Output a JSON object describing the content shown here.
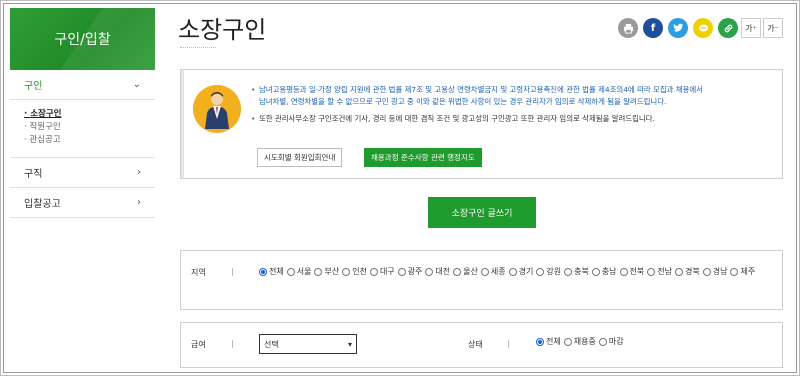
{
  "sidebar": {
    "title": "구인/입찰",
    "menu": [
      {
        "label": "구인",
        "expanded": true
      },
      {
        "label": "구직"
      },
      {
        "label": "입찰공고"
      }
    ],
    "sub_items": [
      "소장구인",
      "직원구인",
      "관심공고"
    ],
    "active_sub": "소장구인"
  },
  "page": {
    "title": "소장구인"
  },
  "share_icons": [
    "print-icon",
    "facebook-icon",
    "twitter-icon",
    "kakao-icon",
    "link-icon"
  ],
  "font_controls": {
    "increase": "가⁺",
    "decrease": "가⁻"
  },
  "notice": {
    "line1_a": "남녀고용평등과 일·가정 양립 지원에 관한 법률 제7조 및 고용상 연령차별금지 및 고령자고용촉진에 관한 법률 제4조의4에 따라 모집과 채용에서",
    "line1_b": "남녀차별, 연령차별을 할 수 없으므로 구인 광고 중 이와 같은 위법한 사항이 있는 경우 관리자가 임의로 삭제하게 됨을 알려드립니다.",
    "line2": "또한 관리사무소장 구인조건에 기사, 경리 등에 대한 겸직 조건 및 광고성의 구인광고 또한 관리자 임의로 삭제됨을 알려드립니다.",
    "btn_member": "시도회별 회원입회안내",
    "btn_guide": "채용과정 준수사항 관련 행정지도"
  },
  "write_button": "소장구인 글쓰기",
  "filters": {
    "region_label": "지역",
    "regions": [
      "전체",
      "서울",
      "부산",
      "인천",
      "대구",
      "광주",
      "대전",
      "울산",
      "세종",
      "경기",
      "강원",
      "충북",
      "충남",
      "전북",
      "전남",
      "경북",
      "경남",
      "제주"
    ],
    "region_selected": "전체",
    "salary_label": "급여",
    "salary_value": "선택",
    "status_label": "상태",
    "statuses": [
      "전체",
      "채용중",
      "마감"
    ],
    "status_selected": "전체"
  },
  "colors": {
    "brand_green": "#1f9a2c",
    "link_blue": "#1e5fb0"
  }
}
